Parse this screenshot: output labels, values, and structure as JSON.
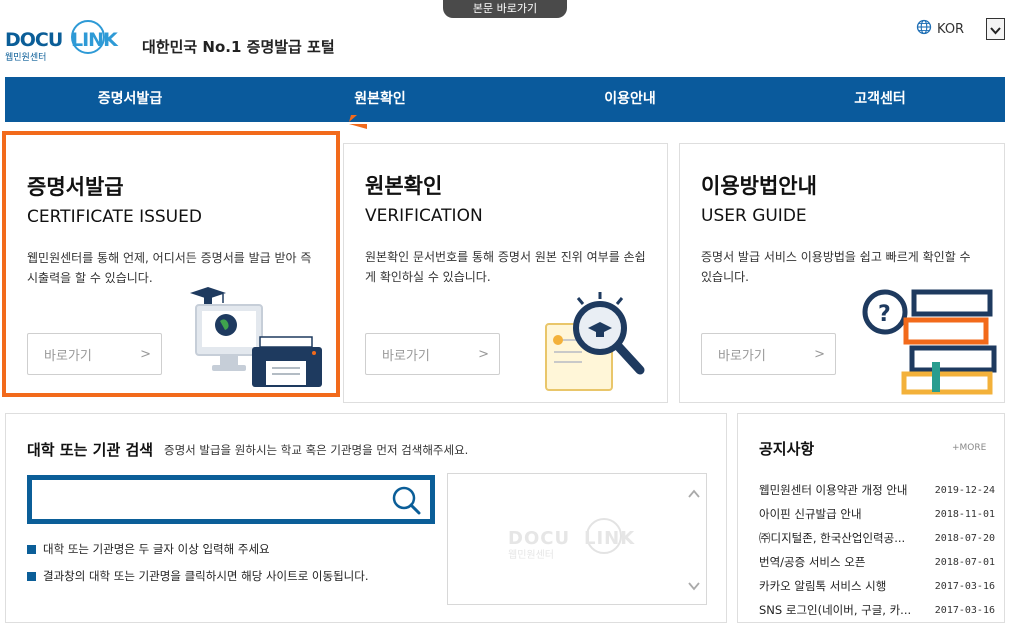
{
  "skip_link": "본문 바로가기",
  "brand": {
    "logo_text": "DOCU LINK",
    "logo_sub": "웹민원센터",
    "slogan": "대한민국 No.1 증명발급 포털"
  },
  "lang": {
    "label": "KOR",
    "icon": "globe-icon"
  },
  "nav": {
    "items": [
      {
        "label": "증명서발급"
      },
      {
        "label": "원본확인"
      },
      {
        "label": "이용안내"
      },
      {
        "label": "고객센터"
      }
    ]
  },
  "cards": [
    {
      "title": "증명서발급",
      "subtitle": "CERTIFICATE ISSUED",
      "description": "웹민원센터를 통해 언제, 어디서든 증명서를 발급 받아 즉시출력을 할 수 있습니다.",
      "button": "바로가기",
      "arrow": ">",
      "icon": "computer-printer-icon"
    },
    {
      "title": "원본확인",
      "subtitle": "VERIFICATION",
      "description": "원본확인 문서번호를 통해 증명서 원본 진위 여부를 손쉽게 확인하실 수 있습니다.",
      "button": "바로가기",
      "arrow": ">",
      "icon": "magnifier-certificate-icon"
    },
    {
      "title": "이용방법안내",
      "subtitle": "USER GUIDE",
      "description": "증명서 발급 서비스 이용방법을 쉽고 빠르게 확인할 수 있습니다.",
      "button": "바로가기",
      "arrow": ">",
      "icon": "question-books-icon"
    }
  ],
  "search": {
    "title": "대학 또는 기관 검색",
    "guide": "증명서 발급을 원하시는 학교 혹은 기관명을 먼저 검색해주세요.",
    "input_value": "",
    "input_placeholder": "",
    "tips": [
      "대학 또는 기관명은 두 글자 이상 입력해 주세요",
      "결과창의 대학 또는 기관명을 클릭하시면 해당 사이트로 이동됩니다."
    ],
    "result_watermark": "DOCU LINK",
    "result_watermark_sub": "웹민원센터"
  },
  "notice": {
    "title": "공지사항",
    "more": "+MORE",
    "items": [
      {
        "text": "웹민원센터 이용약관 개정 안내",
        "date": "2019-12-24"
      },
      {
        "text": "아이핀 신규발급 안내",
        "date": "2018-11-01"
      },
      {
        "text": "㈜디지털존, 한국산업인력공...",
        "date": "2018-07-20"
      },
      {
        "text": "번역/공증 서비스 오픈",
        "date": "2018-07-01"
      },
      {
        "text": "카카오 알림톡 서비스 시행",
        "date": "2017-03-16"
      },
      {
        "text": "SNS 로그인(네이버, 구글, 카...",
        "date": "2017-03-16"
      }
    ]
  },
  "colors": {
    "nav_bg": "#0a5a9c",
    "brand_blue": "#0b5e98",
    "active_border": "#f26a1b",
    "accent_orange": "#f26a1b"
  }
}
